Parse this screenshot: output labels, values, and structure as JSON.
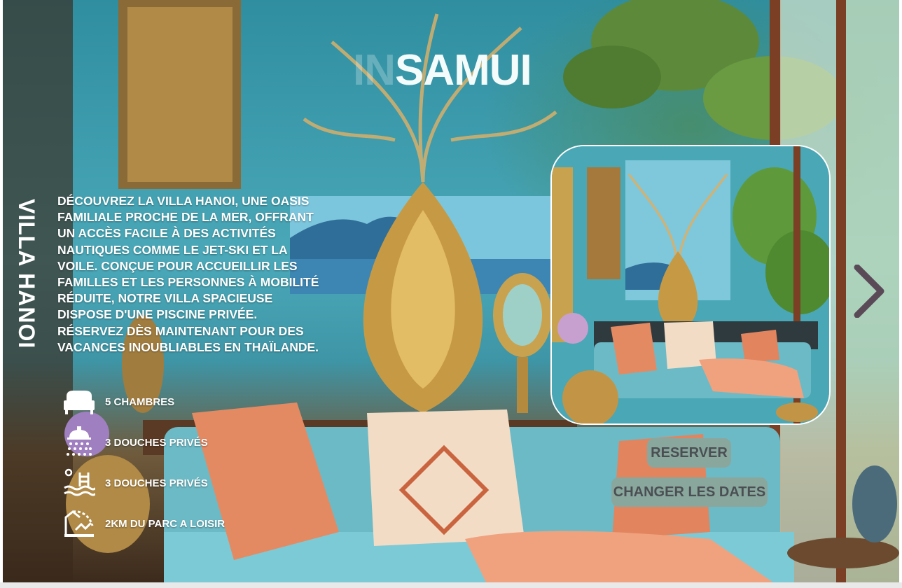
{
  "brand": {
    "prefix": "IN",
    "name": "SAMUI"
  },
  "villa": {
    "title": "VILLA HANOI",
    "description": "Découvrez la Villa Hanoi, une oasis familiale proche de la mer, offrant un accès facile à des activités nautiques comme le jet-ski et la voile. Conçue pour accueillir les familles et les personnes à mobilité réduite, notre villa spacieuse dispose d'une piscine privée. Réservez dès maintenant pour des vacances inoubliables en Thaïlande."
  },
  "features": [
    {
      "icon": "bed-icon",
      "label": "5 CHAMBRES"
    },
    {
      "icon": "shower-icon",
      "label": "3 DOUCHES PRIVÉS"
    },
    {
      "icon": "pool-icon",
      "label": "3 DOUCHES PRIVÉS"
    },
    {
      "icon": "park-icon",
      "label": "2KM DU PARC A LOISIR"
    }
  ],
  "actions": {
    "reserve": "RESERVER",
    "change_dates": "CHANGER LES DATES"
  },
  "carousel": {
    "next_icon": "chevron-right-icon"
  },
  "colors": {
    "button_bg": "#8aa79e",
    "button_text": "#4a4f52",
    "title_text": "#ffffff"
  }
}
